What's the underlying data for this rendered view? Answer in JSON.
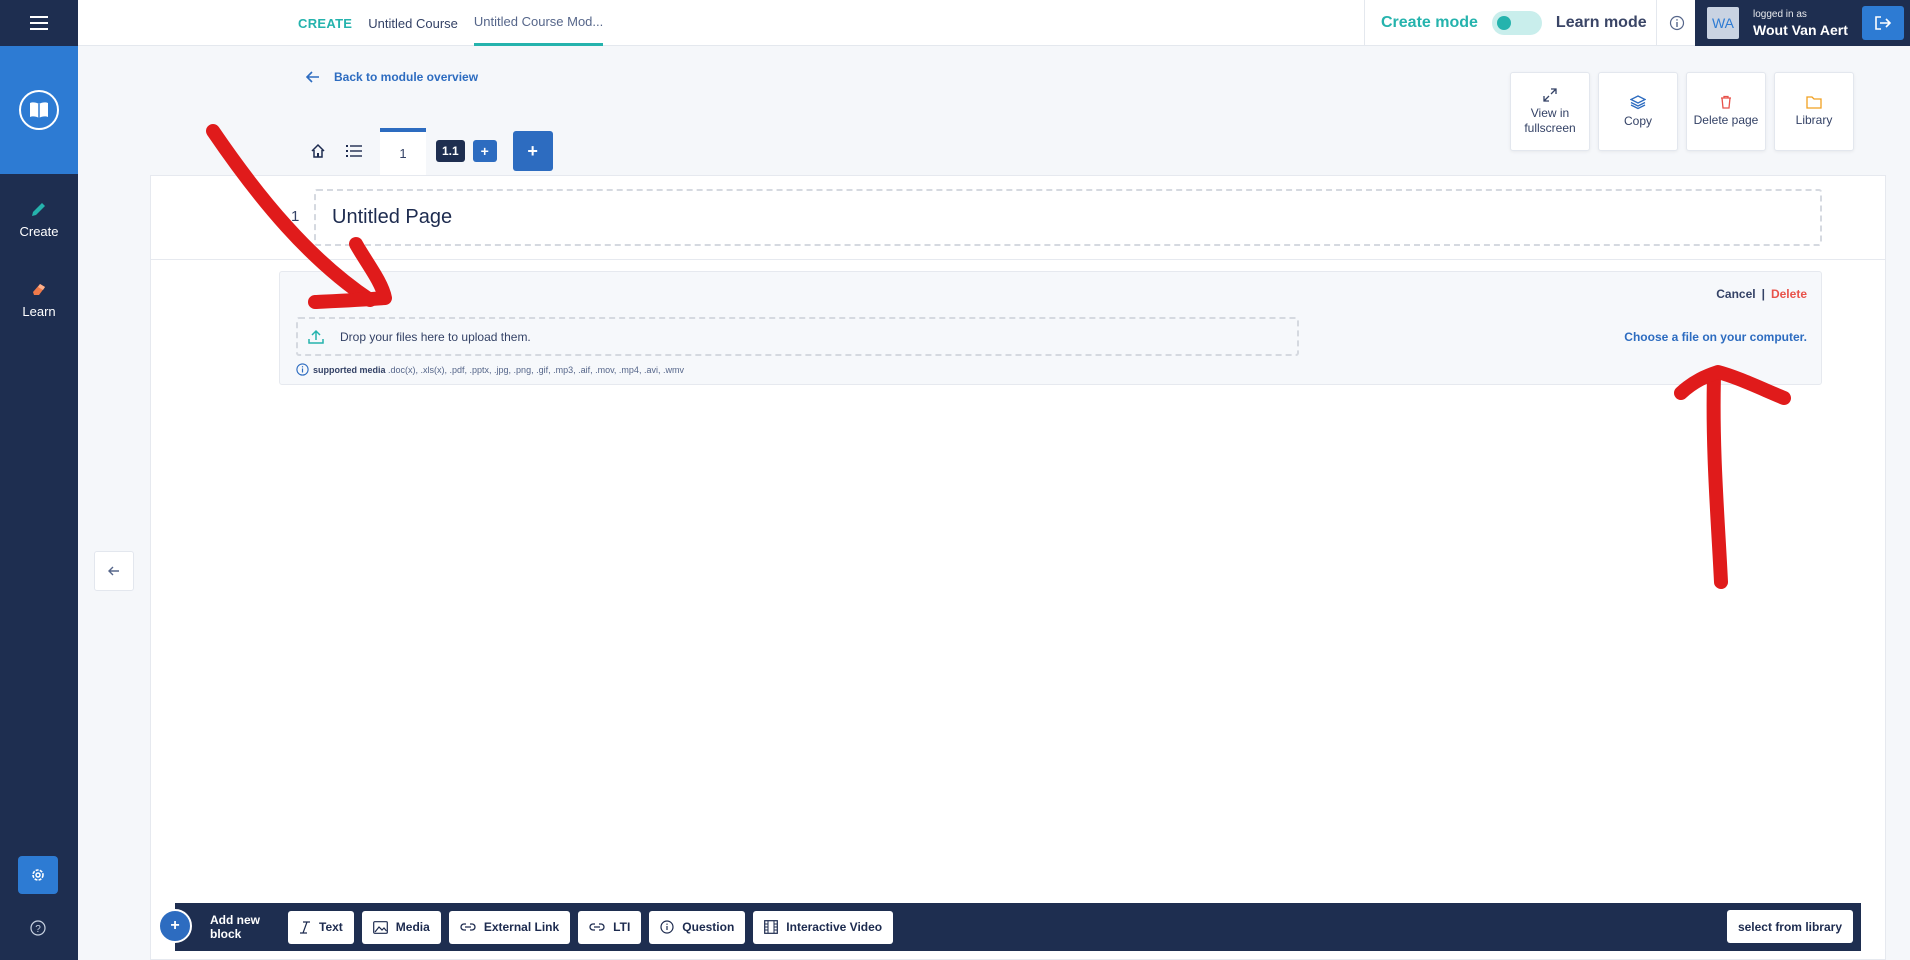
{
  "sidebar": {
    "create_label": "Create",
    "learn_label": "Learn"
  },
  "topbar": {
    "breadcrumb": {
      "create": "CREATE",
      "course": "Untitled Course",
      "module": "Untitled Course Mod..."
    },
    "mode_create": "Create mode",
    "mode_learn": "Learn mode",
    "user": {
      "initials": "WA",
      "logged_in_as": "logged in as",
      "name": "Wout Van Aert"
    }
  },
  "page": {
    "back_link": "Back to module overview",
    "tabs": {
      "page_number": "1",
      "sub_page": "1.1",
      "plus_small": "+",
      "plus_big": "+"
    },
    "actions": {
      "fullscreen": "View in fullscreen",
      "copy": "Copy",
      "delete_page": "Delete page",
      "library": "Library"
    },
    "title_number": "1",
    "title": "Untitled Page"
  },
  "upload_block": {
    "cancel": "Cancel",
    "separator": "|",
    "delete": "Delete",
    "dropzone_text": "Drop your files here to upload them.",
    "choose_file": "Choose a file on your computer.",
    "supported_label": "supported media",
    "supported_formats": " .doc(x), .xls(x), .pdf, .pptx, .jpg, .png, .gif, .mp3, .aif, .mov, .mp4, .avi, .wmv"
  },
  "bottom_toolbar": {
    "add_icon": "+",
    "add_label": "Add new block",
    "buttons": {
      "text": "Text",
      "media": "Media",
      "external_link": "External Link",
      "lti": "LTI",
      "question": "Question",
      "interactive_video": "Interactive Video"
    },
    "select_library": "select from library"
  },
  "colors": {
    "navy": "#1e2e50",
    "blue": "#2d6cc0",
    "teal": "#25b3ad",
    "danger": "#e8524a",
    "annotation_red": "#e01b1b"
  }
}
